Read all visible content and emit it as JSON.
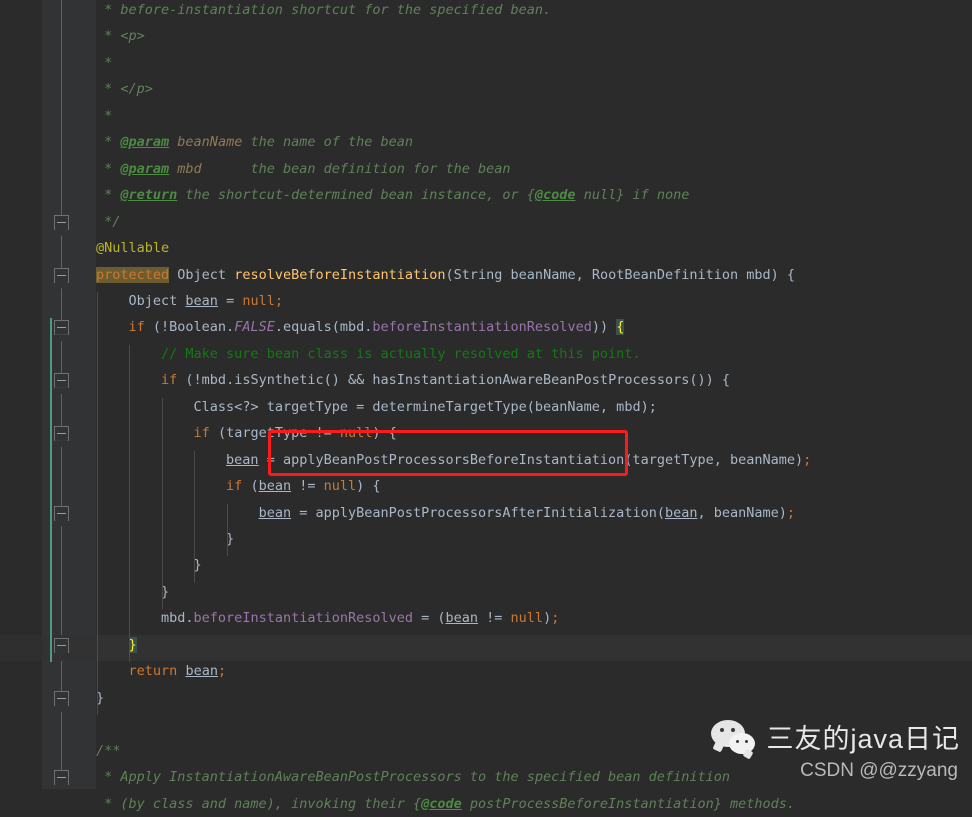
{
  "editor": {
    "theme_background": "#2b2b2b",
    "gutter_background": "#313335",
    "caret_line_background": "#323232",
    "search_highlight_color": "#6b5d2f",
    "bracket_match_color": "#3b514d",
    "change_marker_color": "#4e9a85",
    "annotation_box_color": "#ff1a1a",
    "font_size_px": 13.5,
    "line_height_px": 26.45
  },
  "annotation": {
    "name": "red-highlight-box",
    "target_text": "applyBeanPostProcessorsBeforeInstantiation",
    "color": "#ff1a1a"
  },
  "lines": [
    {
      "n": 1,
      "indent": 0,
      "segments": [
        {
          "t": "jd",
          "v": " * before-instantiation shortcut for the specified bean."
        }
      ]
    },
    {
      "n": 2,
      "indent": 0,
      "segments": [
        {
          "t": "jd",
          "v": " * <p>"
        }
      ]
    },
    {
      "n": 3,
      "indent": 0,
      "segments": [
        {
          "t": "jd",
          "v": " *"
        }
      ]
    },
    {
      "n": 4,
      "indent": 0,
      "segments": [
        {
          "t": "jd",
          "v": " * </p>"
        }
      ]
    },
    {
      "n": 5,
      "indent": 0,
      "segments": [
        {
          "t": "jd",
          "v": " *"
        }
      ]
    },
    {
      "n": 6,
      "indent": 0,
      "segments": [
        {
          "t": "jd",
          "v": " * "
        },
        {
          "t": "jdtag",
          "v": "@param"
        },
        {
          "t": "jdval",
          "v": " beanName"
        },
        {
          "t": "jd",
          "v": " the name of the bean"
        }
      ]
    },
    {
      "n": 7,
      "indent": 0,
      "segments": [
        {
          "t": "jd",
          "v": " * "
        },
        {
          "t": "jdtag",
          "v": "@param"
        },
        {
          "t": "jdval",
          "v": " mbd"
        },
        {
          "t": "jd",
          "v": "      the bean definition for the bean"
        }
      ]
    },
    {
      "n": 8,
      "indent": 0,
      "segments": [
        {
          "t": "jd",
          "v": " * "
        },
        {
          "t": "jdtag",
          "v": "@return"
        },
        {
          "t": "jd",
          "v": " the shortcut-determined bean instance, or {"
        },
        {
          "t": "jdtag",
          "v": "@code"
        },
        {
          "t": "jd",
          "v": " null} if none"
        }
      ]
    },
    {
      "n": 9,
      "indent": 0,
      "segments": [
        {
          "t": "jd",
          "v": " */"
        }
      ]
    },
    {
      "n": 10,
      "indent": 0,
      "segments": [
        {
          "t": "anno",
          "v": "@Nullable"
        }
      ]
    },
    {
      "n": 11,
      "indent": 0,
      "segments": [
        {
          "t": "kw hl",
          "v": "protected"
        },
        {
          "t": "txt",
          "v": " "
        },
        {
          "t": "txt",
          "v": "Object "
        },
        {
          "t": "mth",
          "v": "resolveBeforeInstantiation"
        },
        {
          "t": "txt",
          "v": "(String beanName, RootBeanDefinition mbd) {"
        }
      ]
    },
    {
      "n": 12,
      "indent": 1,
      "segments": [
        {
          "t": "txt",
          "v": "Object "
        },
        {
          "t": "loc",
          "v": "bean"
        },
        {
          "t": "txt",
          "v": " = "
        },
        {
          "t": "kw",
          "v": "null"
        },
        {
          "t": "semi",
          "v": ";"
        }
      ]
    },
    {
      "n": 13,
      "indent": 1,
      "segments": [
        {
          "t": "kw",
          "v": "if"
        },
        {
          "t": "txt",
          "v": " (!Boolean."
        },
        {
          "t": "sfld",
          "v": "FALSE"
        },
        {
          "t": "txt",
          "v": ".equals(mbd."
        },
        {
          "t": "fld",
          "v": "beforeInstantiationResolved"
        },
        {
          "t": "txt",
          "v": ")) "
        },
        {
          "t": "brk",
          "v": "{"
        }
      ]
    },
    {
      "n": 14,
      "indent": 2,
      "segments": [
        {
          "t": "cmt",
          "v": "// Make sure bean class is actually resolved at this point."
        }
      ]
    },
    {
      "n": 15,
      "indent": 2,
      "segments": [
        {
          "t": "kw",
          "v": "if"
        },
        {
          "t": "txt",
          "v": " (!mbd.isSynthetic() && hasInstantiationAwareBeanPostProcessors()) {"
        }
      ]
    },
    {
      "n": 16,
      "indent": 3,
      "segments": [
        {
          "t": "txt",
          "v": "Class<?> targetType = determineTargetType(beanName, mbd);"
        }
      ]
    },
    {
      "n": 17,
      "indent": 3,
      "segments": [
        {
          "t": "kw",
          "v": "if"
        },
        {
          "t": "txt",
          "v": " (targetType != "
        },
        {
          "t": "kw",
          "v": "null"
        },
        {
          "t": "txt",
          "v": ") {"
        }
      ]
    },
    {
      "n": 18,
      "indent": 4,
      "segments": [
        {
          "t": "loc",
          "v": "bean"
        },
        {
          "t": "txt",
          "v": " = applyBeanPostProcessorsBeforeInstantiation(targetType, beanName)"
        },
        {
          "t": "semi",
          "v": ";"
        }
      ]
    },
    {
      "n": 19,
      "indent": 4,
      "segments": [
        {
          "t": "kw",
          "v": "if"
        },
        {
          "t": "txt",
          "v": " ("
        },
        {
          "t": "loc",
          "v": "bean"
        },
        {
          "t": "txt",
          "v": " != "
        },
        {
          "t": "kw",
          "v": "null"
        },
        {
          "t": "txt",
          "v": ") {"
        }
      ]
    },
    {
      "n": 20,
      "indent": 5,
      "segments": [
        {
          "t": "loc",
          "v": "bean"
        },
        {
          "t": "txt",
          "v": " = applyBeanPostProcessorsAfterInitialization("
        },
        {
          "t": "loc",
          "v": "bean"
        },
        {
          "t": "txt",
          "v": ", beanName)"
        },
        {
          "t": "semi",
          "v": ";"
        }
      ]
    },
    {
      "n": 21,
      "indent": 4,
      "segments": [
        {
          "t": "txt",
          "v": "}"
        }
      ]
    },
    {
      "n": 22,
      "indent": 3,
      "segments": [
        {
          "t": "txt",
          "v": "}"
        }
      ]
    },
    {
      "n": 23,
      "indent": 2,
      "segments": [
        {
          "t": "txt",
          "v": "}"
        }
      ]
    },
    {
      "n": 24,
      "indent": 2,
      "segments": [
        {
          "t": "txt",
          "v": "mbd."
        },
        {
          "t": "fld",
          "v": "beforeInstantiationResolved"
        },
        {
          "t": "txt",
          "v": " = ("
        },
        {
          "t": "loc",
          "v": "bean"
        },
        {
          "t": "txt",
          "v": " != "
        },
        {
          "t": "kw",
          "v": "null"
        },
        {
          "t": "txt",
          "v": ")"
        },
        {
          "t": "semi",
          "v": ";"
        }
      ]
    },
    {
      "n": 25,
      "indent": 1,
      "segments": [
        {
          "t": "brk",
          "v": "}"
        }
      ]
    },
    {
      "n": 26,
      "indent": 1,
      "segments": [
        {
          "t": "kw",
          "v": "return"
        },
        {
          "t": "txt",
          "v": " "
        },
        {
          "t": "loc",
          "v": "bean"
        },
        {
          "t": "semi",
          "v": ";"
        }
      ]
    },
    {
      "n": 27,
      "indent": 0,
      "segments": [
        {
          "t": "txt",
          "v": "}"
        }
      ]
    },
    {
      "n": 28,
      "indent": 0,
      "segments": [
        {
          "t": "txt",
          "v": ""
        }
      ]
    },
    {
      "n": 29,
      "indent": 0,
      "segments": [
        {
          "t": "jd",
          "v": "/**"
        }
      ]
    },
    {
      "n": 30,
      "indent": 0,
      "segments": [
        {
          "t": "jd",
          "v": " * Apply InstantiationAwareBeanPostProcessors to the specified bean definition"
        }
      ]
    },
    {
      "n": 31,
      "indent": 0,
      "segments": [
        {
          "t": "jd",
          "v": " * (by class and name), invoking their {"
        },
        {
          "t": "jdtag",
          "v": "@code"
        },
        {
          "t": "jd",
          "v": " postProcessBeforeInstantiation} methods."
        }
      ]
    }
  ],
  "watermark": {
    "icon": "wechat-icon",
    "title": "三友的java日记",
    "subtitle": "CSDN @@zzyang"
  }
}
